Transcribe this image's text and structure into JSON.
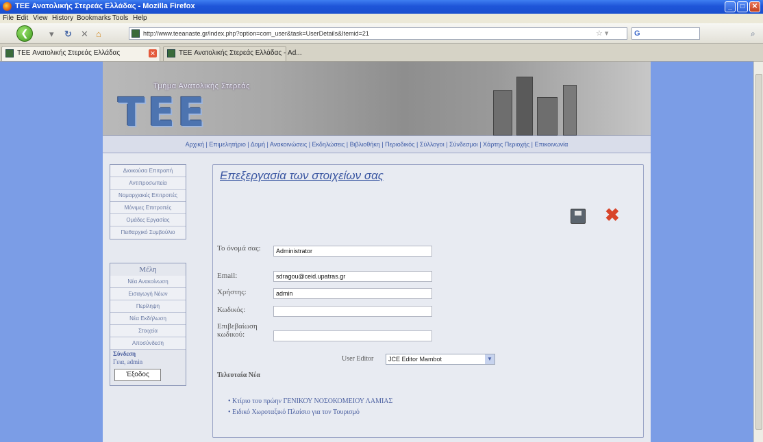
{
  "window": {
    "title": "TEE Ανατολικής Στερεάς Ελλάδας - Mozilla Firefox",
    "buttons": [
      "_",
      "□",
      "✕"
    ]
  },
  "menu": [
    "File",
    "Edit",
    "View",
    "History",
    "Bookmarks",
    "Tools",
    "Help"
  ],
  "nav": {
    "url": "http://www.teeanaste.gr/index.php?option=com_user&task=UserDetails&Itemid=21",
    "search_icon": "G"
  },
  "tabs": [
    {
      "label": "TEE Ανατολικής Στερεάς Ελλάδας",
      "active": true
    },
    {
      "label": "TEE Ανατολικής Στερεάς Ελλάδας - Ad...",
      "active": false
    }
  ],
  "banner": {
    "subtitle": "Τμήμα Ανατολικής Στερεάς",
    "logo": "ΤΕΕ"
  },
  "links_bar": "Αρχική | Επιμελητήριο | Δομή | Ανακοινώσεις | Εκδηλώσεις | Βιβλιοθήκη | Περιοδικός | Σύλλογοι | Σύνδεσμοι | Χάρτης Περιοχής | Επικοινωνία",
  "sidebar": {
    "committees": [
      "Διοικούσα Επιτροπή",
      "Αντιπροσωπεία",
      "Νομαρχιακές Επιτροπές",
      "Μόνιμες Επιτροπές",
      "Ομάδες Εργασίας",
      "Πειθαρχικό Συμβούλιο"
    ],
    "members_title": "Μέλη",
    "members": [
      "Νέα Ανακοίνωση",
      "Εισαγωγή Νέων",
      "Περίληψη",
      "Νέα Εκδήλωση",
      "Στοιχεία",
      "Αποσύνδεση"
    ],
    "login_title": "Σύνδεση",
    "greeting": "Γεια, admin",
    "logout": "Έξοδος"
  },
  "form": {
    "title": "Επεξεργασία των στοιχείων σας",
    "name_label": "Το όνομά σας:",
    "name_value": "Administrator",
    "email_label": "Email:",
    "email_value": "sdragou@ceid.upatras.gr",
    "user_label": "Χρήστης:",
    "user_value": "admin",
    "password_label": "Κωδικός:",
    "password_value": "",
    "confirm_label": "Επιβεβαίωση κωδικού:",
    "confirm_value": "",
    "editor_label": "User Editor",
    "editor_value": "JCE Editor Mambot"
  },
  "news": {
    "title": "Τελευταία Νέα",
    "items": [
      "Κτίριο του πρώην ΓΕΝΙΚΟΥ ΝΟΣΟΚΟΜΕΙΟΥ ΛΑΜΙΑΣ",
      "Ειδικό Χωροταξικό Πλαίσιο για τον Τουρισμό"
    ]
  },
  "colors": {
    "desktop": "#7b9de6",
    "accent": "#3b57a2",
    "titlebar": "#1e55d8"
  }
}
